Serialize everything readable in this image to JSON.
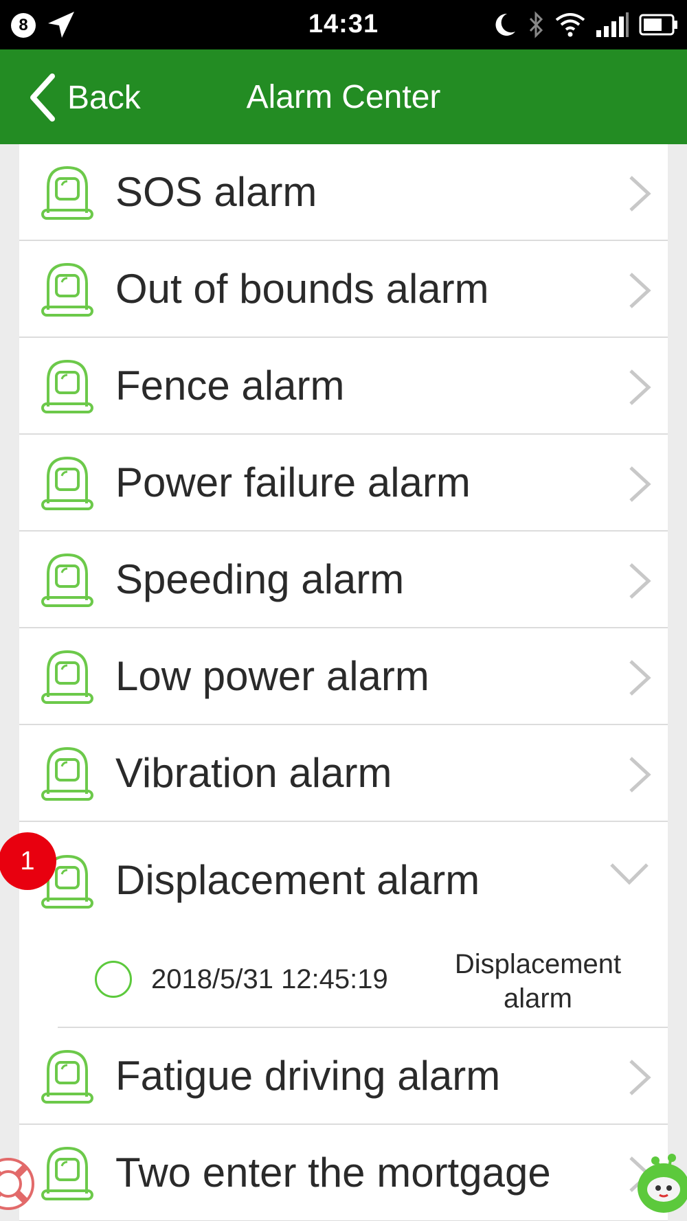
{
  "status_bar": {
    "notification_count": "8",
    "time": "14:31"
  },
  "header": {
    "back_label": "Back",
    "title": "Alarm Center"
  },
  "colors": {
    "header_bg": "#238c23",
    "icon_green": "#6cc94a",
    "badge_red": "#e8000f"
  },
  "alarms": [
    {
      "label": "SOS alarm"
    },
    {
      "label": "Out of bounds alarm"
    },
    {
      "label": "Fence alarm"
    },
    {
      "label": "Power failure alarm"
    },
    {
      "label": "Speeding alarm"
    },
    {
      "label": "Low power alarm"
    },
    {
      "label": "Vibration alarm"
    },
    {
      "label": "Displacement alarm",
      "badge": "1",
      "expanded": true
    },
    {
      "label": "Fatigue driving alarm"
    },
    {
      "label": "Two enter the mortgage"
    }
  ],
  "displacement_records": [
    {
      "time": "2018/5/31 12:45:19",
      "type": "Displacement alarm"
    }
  ]
}
